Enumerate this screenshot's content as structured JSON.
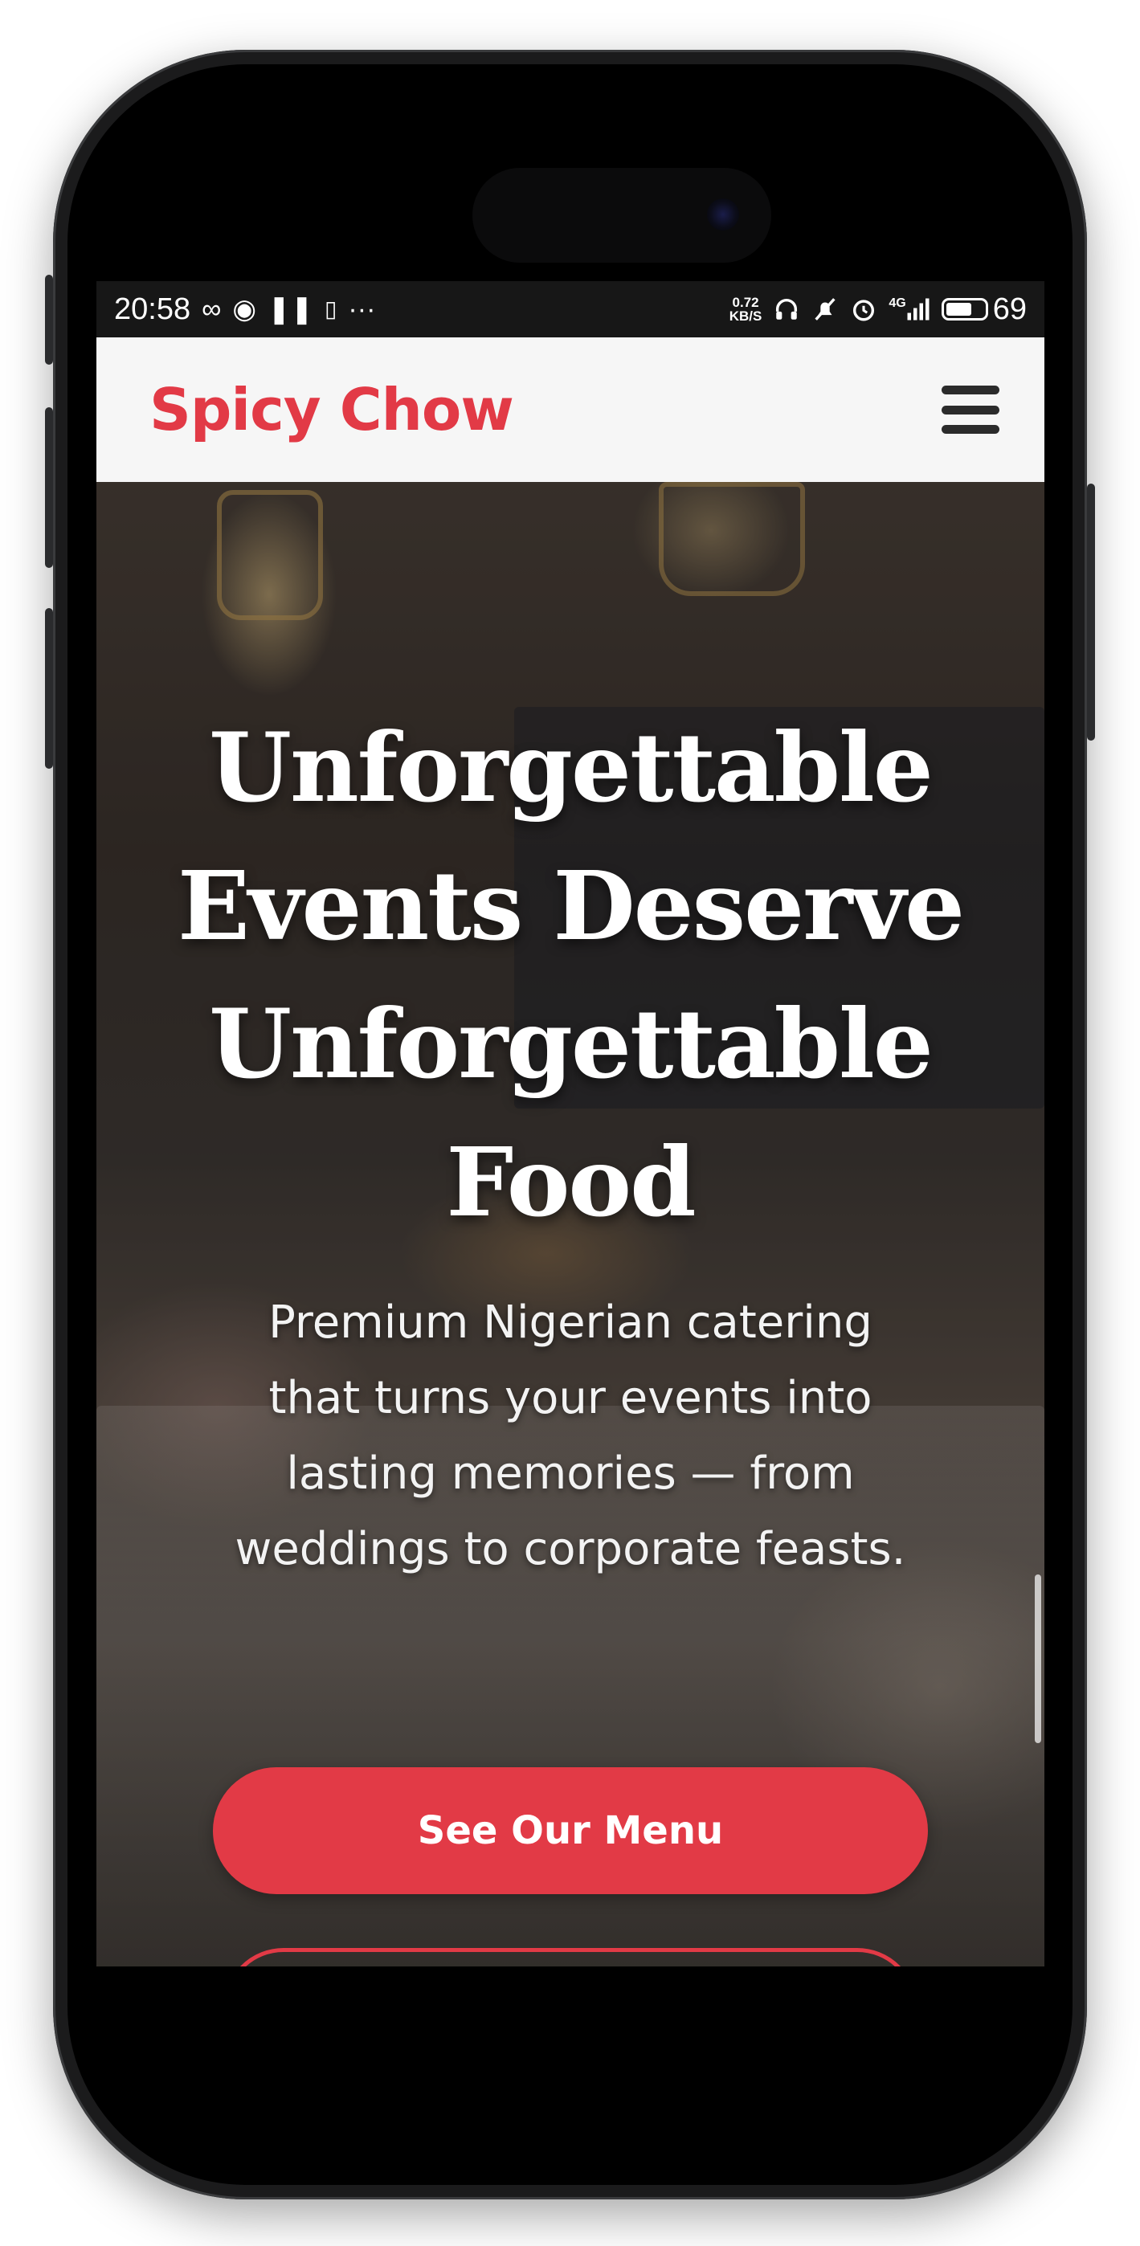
{
  "status_bar": {
    "time": "20:58",
    "left_icons": [
      "infinity-icon",
      "location-drop-icon",
      "pause-icon",
      "sim-icon",
      "more-dots-icon"
    ],
    "net_speed_value": "0.72",
    "net_speed_unit": "KB/S",
    "right_icons": [
      "headphones-icon",
      "muted-bell-icon",
      "alarm-icon",
      "signal-4g-icon"
    ],
    "network_label": "4G",
    "battery_level": "69",
    "battery_fraction": 0.69
  },
  "header": {
    "brand": "Spicy Chow",
    "menu_icon": "hamburger-menu-icon",
    "brand_color": "#e23a46"
  },
  "hero": {
    "title": "Unforgettable Events Deserve Unforgettable Food",
    "subtitle": "Premium Nigerian catering that turns your events into lasting memories — from weddings to corporate feasts.",
    "primary_cta": "See Our Menu",
    "accent_color": "#e23a46"
  }
}
